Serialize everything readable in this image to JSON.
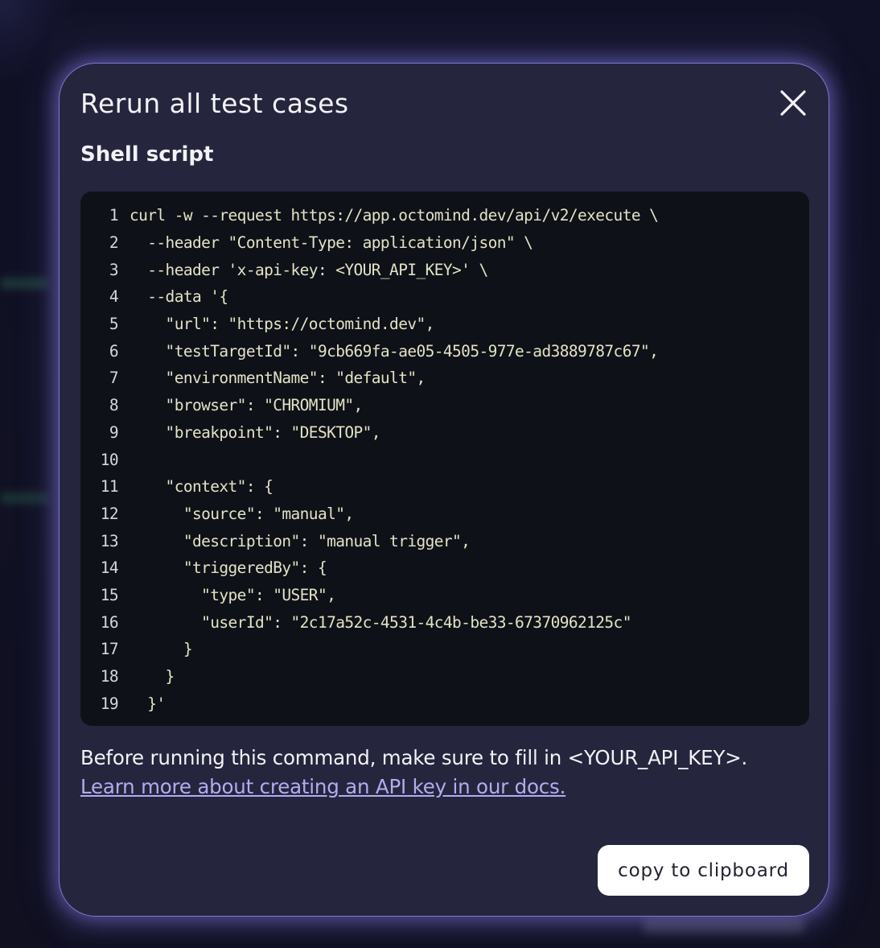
{
  "modal": {
    "title": "Rerun all test cases",
    "section_title": "Shell script",
    "close_icon": "close-icon",
    "code_lines": [
      {
        "no": "1",
        "text": "curl -w --request https://app.octomind.dev/api/v2/execute \\"
      },
      {
        "no": "2",
        "text": "  --header \"Content-Type: application/json\" \\"
      },
      {
        "no": "3",
        "text": "  --header 'x-api-key: <YOUR_API_KEY>' \\"
      },
      {
        "no": "4",
        "text": "  --data '{"
      },
      {
        "no": "5",
        "text": "    \"url\": \"https://octomind.dev\","
      },
      {
        "no": "6",
        "text": "    \"testTargetId\": \"9cb669fa-ae05-4505-977e-ad3889787c67\","
      },
      {
        "no": "7",
        "text": "    \"environmentName\": \"default\","
      },
      {
        "no": "8",
        "text": "    \"browser\": \"CHROMIUM\","
      },
      {
        "no": "9",
        "text": "    \"breakpoint\": \"DESKTOP\","
      },
      {
        "no": "10",
        "text": ""
      },
      {
        "no": "11",
        "text": "    \"context\": {"
      },
      {
        "no": "12",
        "text": "      \"source\": \"manual\","
      },
      {
        "no": "13",
        "text": "      \"description\": \"manual trigger\","
      },
      {
        "no": "14",
        "text": "      \"triggeredBy\": {"
      },
      {
        "no": "15",
        "text": "        \"type\": \"USER\","
      },
      {
        "no": "16",
        "text": "        \"userId\": \"2c17a52c-4531-4c4b-be33-67370962125c\""
      },
      {
        "no": "17",
        "text": "      }"
      },
      {
        "no": "18",
        "text": "    }"
      },
      {
        "no": "19",
        "text": "  }'"
      }
    ],
    "note": "Before running this command, make sure to fill in <YOUR_API_KEY>.",
    "docs_link": "Learn more about creating an API key in our docs.",
    "copy_button": "copy to clipboard"
  },
  "colors": {
    "modal_bg": "#25263d",
    "modal_border": "#7c78d6",
    "code_bg": "#0f1119",
    "link": "#b3abf1",
    "button_bg": "#ffffff"
  }
}
